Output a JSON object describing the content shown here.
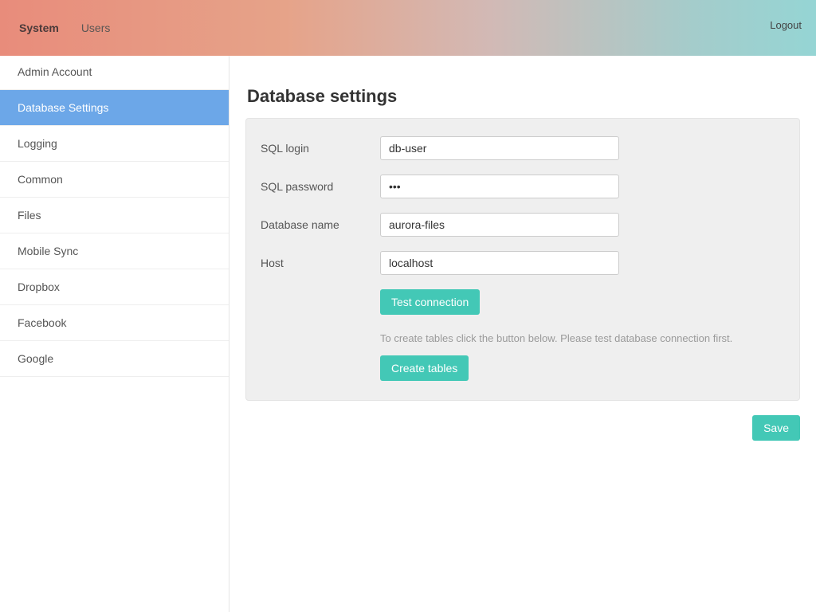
{
  "topbar": {
    "tabs": [
      {
        "label": "System",
        "active": true
      },
      {
        "label": "Users",
        "active": false
      }
    ],
    "logout": "Logout"
  },
  "sidebar": {
    "items": [
      {
        "label": "Admin Account",
        "active": false
      },
      {
        "label": "Database Settings",
        "active": true
      },
      {
        "label": "Logging",
        "active": false
      },
      {
        "label": "Common",
        "active": false
      },
      {
        "label": "Files",
        "active": false
      },
      {
        "label": "Mobile Sync",
        "active": false
      },
      {
        "label": "Dropbox",
        "active": false
      },
      {
        "label": "Facebook",
        "active": false
      },
      {
        "label": "Google",
        "active": false
      }
    ]
  },
  "page": {
    "title": "Database settings"
  },
  "form": {
    "sql_login": {
      "label": "SQL login",
      "value": "db-user"
    },
    "sql_password": {
      "label": "SQL password",
      "value": "•••"
    },
    "db_name": {
      "label": "Database name",
      "value": "aurora-files"
    },
    "host": {
      "label": "Host",
      "value": "localhost"
    },
    "test_btn": "Test connection",
    "hint": "To create tables click the button below. Please test database connection first.",
    "create_btn": "Create tables",
    "save_btn": "Save"
  }
}
